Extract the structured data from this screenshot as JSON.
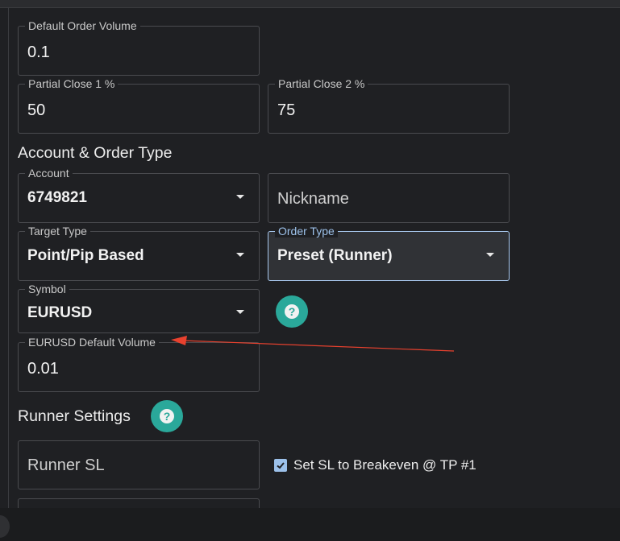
{
  "fields": {
    "default_order_volume": {
      "label": "Default Order Volume",
      "value": "0.1"
    },
    "partial_close_1": {
      "label": "Partial Close 1 %",
      "value": "50"
    },
    "partial_close_2": {
      "label": "Partial Close 2 %",
      "value": "75"
    },
    "account": {
      "label": "Account",
      "value": "6749821"
    },
    "nickname": {
      "placeholder": "Nickname"
    },
    "target_type": {
      "label": "Target Type",
      "value": "Point/Pip Based"
    },
    "order_type": {
      "label": "Order Type",
      "value": "Preset (Runner)"
    },
    "symbol": {
      "label": "Symbol",
      "value": "EURUSD"
    },
    "symbol_default_volume": {
      "label": "EURUSD Default Volume",
      "value": "0.01"
    },
    "runner_sl": {
      "placeholder": "Runner SL"
    }
  },
  "sections": {
    "account_order_type": "Account & Order Type",
    "runner_settings": "Runner Settings"
  },
  "help_icon_glyph": "?",
  "breakeven_checkbox": {
    "label": "Set SL to Breakeven @ TP #1",
    "checked": true
  },
  "colors": {
    "background": "#1f2023",
    "accent_teal": "#2aa89a",
    "focus_blue": "#a8c8ee",
    "annotation_arrow": "#e8412e"
  }
}
